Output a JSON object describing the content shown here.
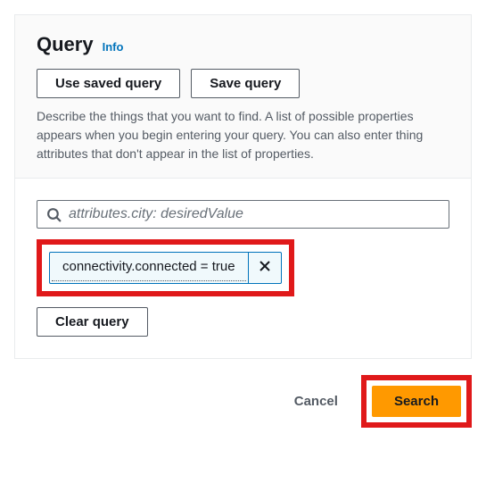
{
  "panel": {
    "title": "Query",
    "info_label": "Info",
    "use_saved_label": "Use saved query",
    "save_query_label": "Save query",
    "description": "Describe the things that you want to find. A list of possible properties appears when you begin entering your query. You can also enter thing attributes that don't appear in the list of properties."
  },
  "search": {
    "placeholder": "attributes.city: desiredValue"
  },
  "chip": {
    "text": "connectivity.connected = true"
  },
  "clear_label": "Clear query",
  "footer": {
    "cancel_label": "Cancel",
    "search_label": "Search"
  }
}
